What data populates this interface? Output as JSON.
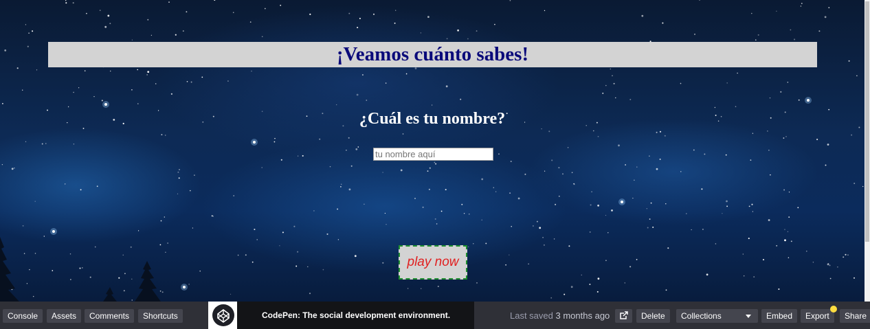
{
  "preview": {
    "title": "¡Veamos cuánto sabes!",
    "question": "¿Cuál es tu nombre?",
    "name_input": {
      "placeholder": "tu nombre aquí",
      "value": ""
    },
    "play_button": "play now"
  },
  "bottom_bar": {
    "left_buttons": [
      "Console",
      "Assets",
      "Comments",
      "Shortcuts"
    ],
    "promo_text": "CodePen: The social development environment.",
    "last_saved_label": "Last saved",
    "last_saved_age": "3 months ago",
    "open_external_icon": "external-link-icon",
    "delete_label": "Delete",
    "collections_label": "Collections",
    "embed_label": "Embed",
    "export_label": "Export",
    "share_label": "Share"
  },
  "colors": {
    "title_background": "#d3d3d3",
    "title_text": "#0a0a7a",
    "question_text": "#ffffff",
    "play_text": "#e02020",
    "play_border": "#1f8f2f",
    "bar_background": "#2f3037",
    "bar_button": "#44454e",
    "notification_dot": "#ffdd40"
  }
}
